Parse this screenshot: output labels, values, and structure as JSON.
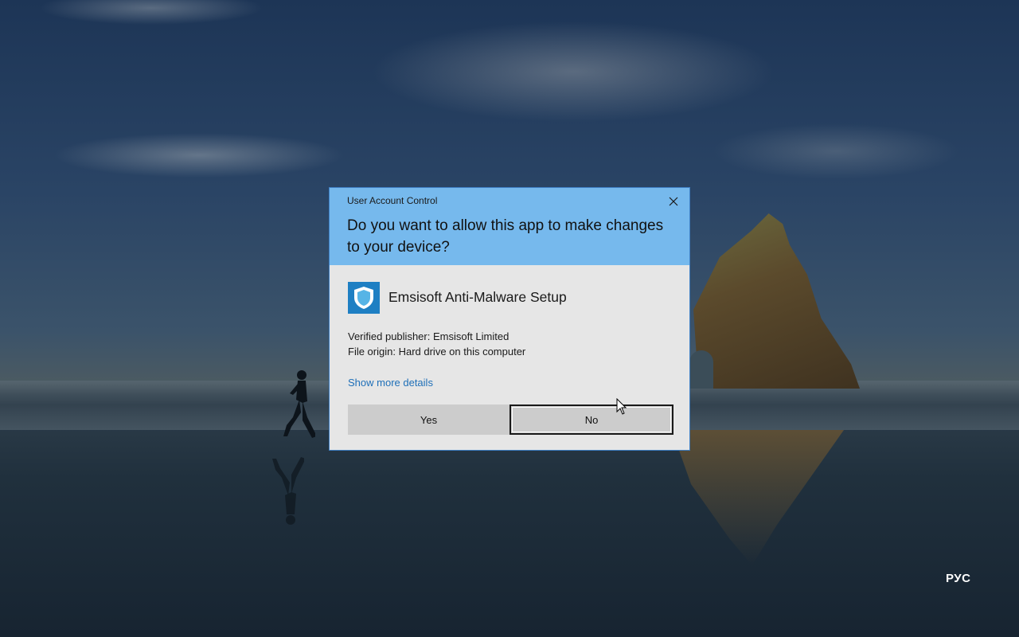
{
  "dialog": {
    "caption": "User Account Control",
    "question": "Do you want to allow this app to make changes to your device?",
    "close_icon": "close-icon",
    "app": {
      "name": "Emsisoft Anti-Malware Setup",
      "icon": "shield-icon"
    },
    "publisher": "Verified publisher: Emsisoft Limited",
    "origin": "File origin: Hard drive on this computer",
    "details_link": "Show more details",
    "yes_label": "Yes",
    "no_label": "No"
  },
  "taskbar": {
    "language": "РУС"
  },
  "colors": {
    "header_blue": "#76b9ed",
    "dialog_body": "#e6e6e6",
    "link_blue": "#1e6fb8",
    "app_icon_blue": "#1e7fc3"
  }
}
